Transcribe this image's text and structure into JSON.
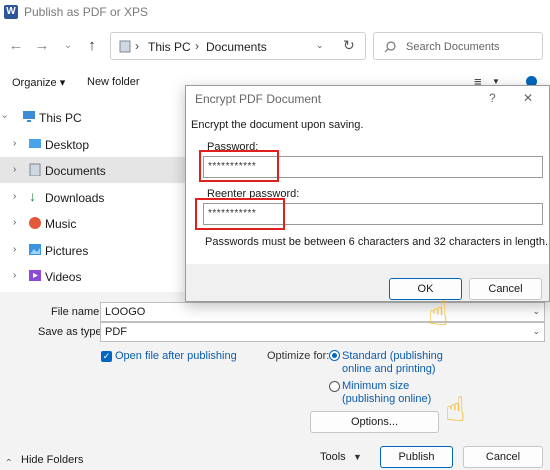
{
  "window": {
    "title": "Publish as PDF or XPS",
    "app_icon": "W"
  },
  "address": {
    "crumbs": [
      "This PC",
      "Documents"
    ],
    "search_placeholder": "Search Documents"
  },
  "toolbar": {
    "organize": "Organize ▾",
    "new_folder": "New folder"
  },
  "sidebar": {
    "items": [
      {
        "label": "This PC",
        "icon": "pc-icon"
      },
      {
        "label": "Desktop",
        "icon": "desktop-icon"
      },
      {
        "label": "Documents",
        "icon": "documents-icon"
      },
      {
        "label": "Downloads",
        "icon": "downloads-icon"
      },
      {
        "label": "Music",
        "icon": "music-icon"
      },
      {
        "label": "Pictures",
        "icon": "pictures-icon"
      },
      {
        "label": "Videos",
        "icon": "videos-icon"
      }
    ]
  },
  "form": {
    "file_name_label": "File name:",
    "file_name_value": "LOOGO",
    "save_type_label": "Save as type:",
    "save_type_value": "PDF",
    "open_after_label": "Open file after publishing",
    "optimize_label": "Optimize for:",
    "standard_label_1": "Standard (publishing",
    "standard_label_2": "online and printing)",
    "minimum_label_1": "Minimum size",
    "minimum_label_2": "(publishing online)",
    "options_button": "Options...",
    "hide_folders": "Hide Folders",
    "tools": "Tools",
    "publish_button": "Publish",
    "cancel_button": "Cancel"
  },
  "dialog": {
    "title": "Encrypt PDF Document",
    "help": "?",
    "close": "✕",
    "instruction": "Encrypt the document upon saving.",
    "password_label": "Password:",
    "password_value": "***********",
    "reenter_label": "Reenter password:",
    "reenter_value": "***********",
    "hint": "Passwords must be between 6 characters and 32 characters in length.",
    "ok_button": "OK",
    "cancel_button": "Cancel"
  },
  "colors": {
    "accent": "#0067c0",
    "highlight_box": "#e0201c",
    "cursor": "#f2b516"
  }
}
